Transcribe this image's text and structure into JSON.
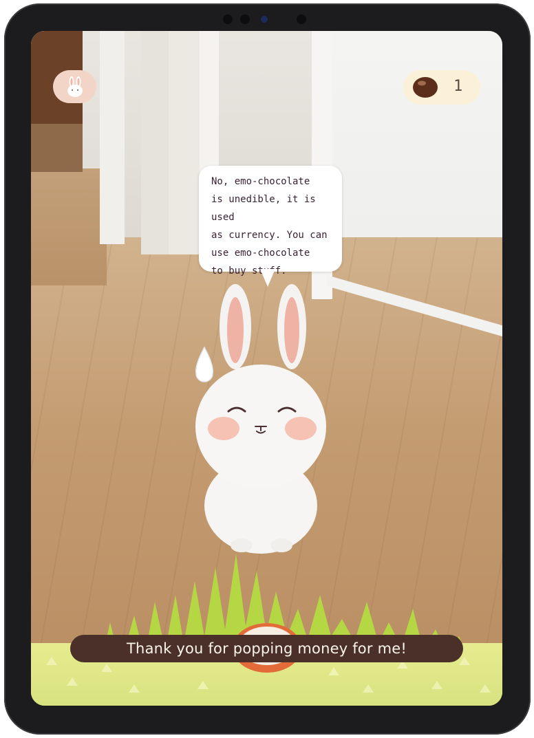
{
  "top_bar": {
    "avatar_icon": "bunny-face-icon",
    "currency_icon": "chocolate-bean-icon",
    "currency_count": "1"
  },
  "speech_bubble": {
    "lines": [
      "No, emo-chocolate",
      "is unedible, it is used",
      "as currency. You can",
      "use emo-chocolate",
      "to buy stuff."
    ]
  },
  "character": {
    "icon": "white-bunny-character",
    "sweat_drop_icon": "sweat-drop-icon"
  },
  "bottom": {
    "action_icon": "coin-pop-icon",
    "toast": "Thank you for popping money for me!"
  },
  "colors": {
    "toast_bg": "#4a3028",
    "coin_pill_bg": "#fbf1d9",
    "avatar_bg": "#f3d5c7",
    "grass": "#a9cf3c"
  }
}
